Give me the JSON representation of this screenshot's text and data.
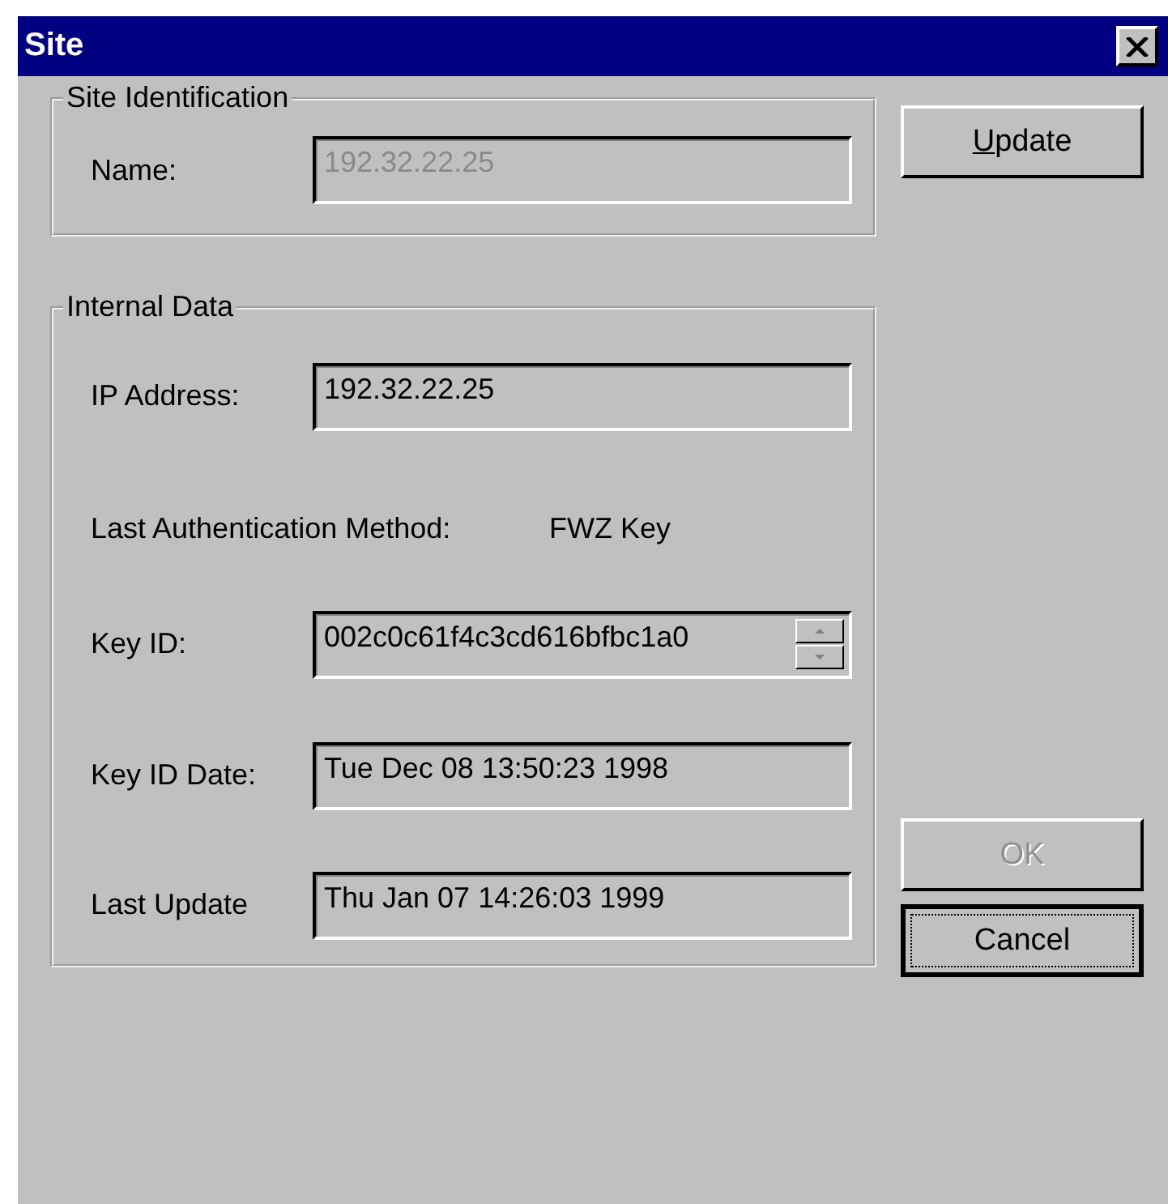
{
  "window": {
    "title": "Site"
  },
  "site_identification": {
    "legend": "Site Identification",
    "name": {
      "label": "Name:",
      "value": "192.32.22.25",
      "disabled": true
    }
  },
  "internal_data": {
    "legend": "Internal Data",
    "rows": [
      {
        "kind": "field",
        "label": "IP Address:",
        "value": "192.32.22.25",
        "disabled": false
      },
      {
        "kind": "text",
        "label": "Last Authentication Method:",
        "value": "FWZ Key"
      },
      {
        "kind": "spin",
        "label": "Key ID:",
        "value": "002c0c61f4c3cd616bfbc1a0",
        "disabled": false
      },
      {
        "kind": "field",
        "label": "Key ID Date:",
        "value": "Tue Dec 08 13:50:23 1998",
        "disabled": false
      },
      {
        "kind": "field",
        "label": "Last Update",
        "value": "Thu Jan 07 14:26:03 1999",
        "disabled": false
      }
    ]
  },
  "buttons": [
    {
      "label": "Update",
      "first_letter_underlined": true,
      "disabled": false,
      "focused": false
    },
    {
      "label": "OK",
      "disabled": true,
      "focused": false
    },
    {
      "label": "Cancel",
      "disabled": false,
      "focused": true
    }
  ]
}
